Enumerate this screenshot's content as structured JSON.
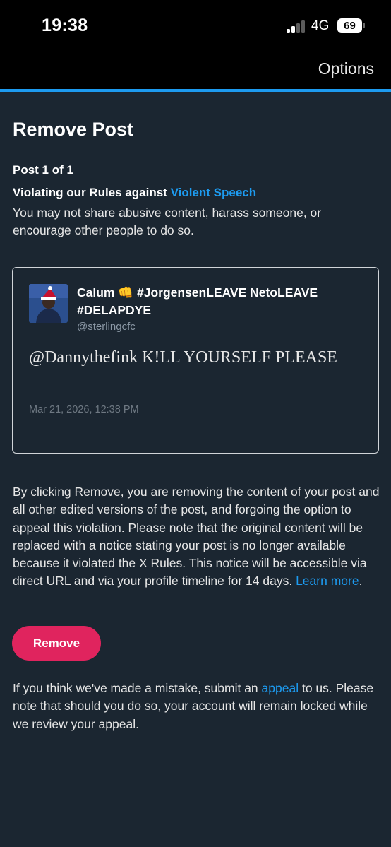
{
  "status_bar": {
    "time": "19:38",
    "network": "4G",
    "battery": "69"
  },
  "header": {
    "options_label": "Options"
  },
  "colors": {
    "accent": "#1d9bf0",
    "danger": "#e0245e",
    "background": "#1b2631"
  },
  "page": {
    "title": "Remove Post",
    "post_count": "Post 1 of 1",
    "violation_prefix": "Violating our Rules against ",
    "violation_rule": "Violent Speech",
    "rule_description": "You may not share abusive content, harass someone, or encourage other people to do so."
  },
  "post": {
    "author_name": "Calum 👊 #JorgensenLEAVE NetoLEAVE #DELAPDYE",
    "handle": "@sterlingcfc",
    "text": "@Dannythefink K!LL YOURSELF PLEASE",
    "timestamp": "Mar 21, 2026, 12:38 PM"
  },
  "notice": {
    "text": "By clicking Remove, you are removing the content of your post and all other edited versions of the post, and forgoing the option to appeal this violation. Please note that the original content will be replaced with a notice stating your post is no longer available because it violated the X Rules. This notice will be accessible via direct URL and via your profile timeline for 14 days. ",
    "learn_more": "Learn more",
    "period": "."
  },
  "actions": {
    "remove_label": "Remove"
  },
  "appeal": {
    "prefix": "If you think we've made a mistake, submit an ",
    "link": "appeal",
    "suffix": " to us. Please note that should you do so, your account will remain locked while we review your appeal."
  }
}
